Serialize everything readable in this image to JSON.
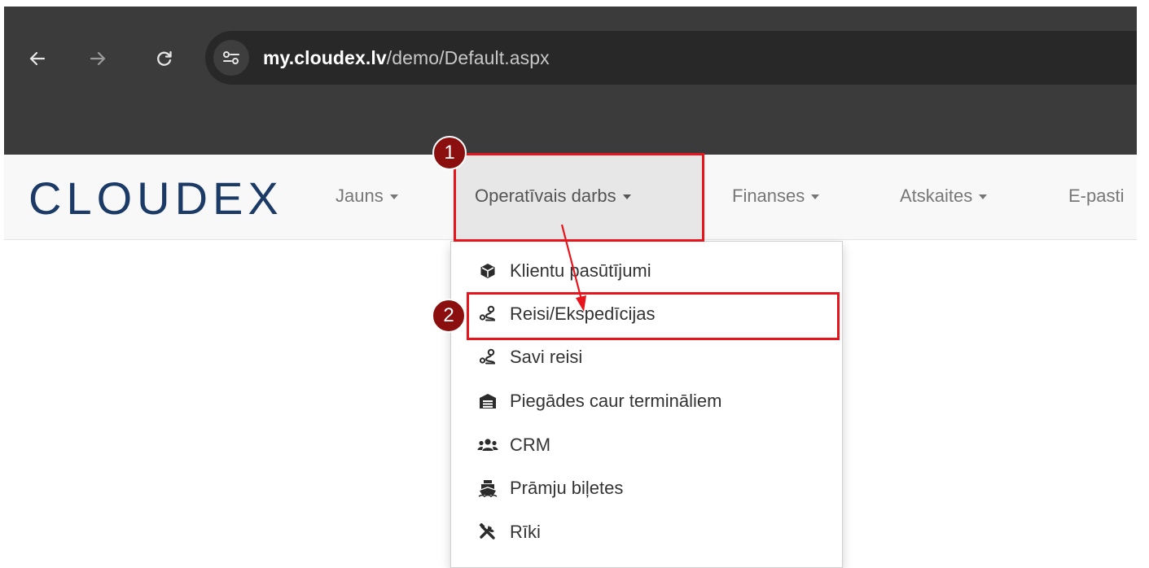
{
  "browser": {
    "url_host": "my.cloudex.lv",
    "url_path": "/demo/Default.aspx",
    "back_icon": "arrow-left-icon",
    "forward_icon": "arrow-right-icon",
    "reload_icon": "reload-icon",
    "site_info_icon": "tune-icon"
  },
  "app": {
    "logo": "CLOUDEX",
    "menu": [
      {
        "label": "Jauns"
      },
      {
        "label": "Operatīvais darbs"
      },
      {
        "label": "Finanses"
      },
      {
        "label": "Atskaites"
      },
      {
        "label": "E-pasti"
      }
    ],
    "dropdown": [
      {
        "label": "Klientu pasūtījumi",
        "icon": "box-icon"
      },
      {
        "label": "Reisi/Ekspedīcijas",
        "icon": "route-icon"
      },
      {
        "label": "Savi reisi",
        "icon": "route-icon"
      },
      {
        "label": "Piegādes caur termināliem",
        "icon": "warehouse-icon"
      },
      {
        "label": "CRM",
        "icon": "users-icon"
      },
      {
        "label": "Prāmju biļetes",
        "icon": "ship-icon"
      },
      {
        "label": "Rīki",
        "icon": "tools-icon"
      }
    ]
  },
  "annotations": {
    "step1": "1",
    "step2": "2",
    "highlight_color": "#e8141c",
    "badge_color": "#8b0f0f"
  }
}
